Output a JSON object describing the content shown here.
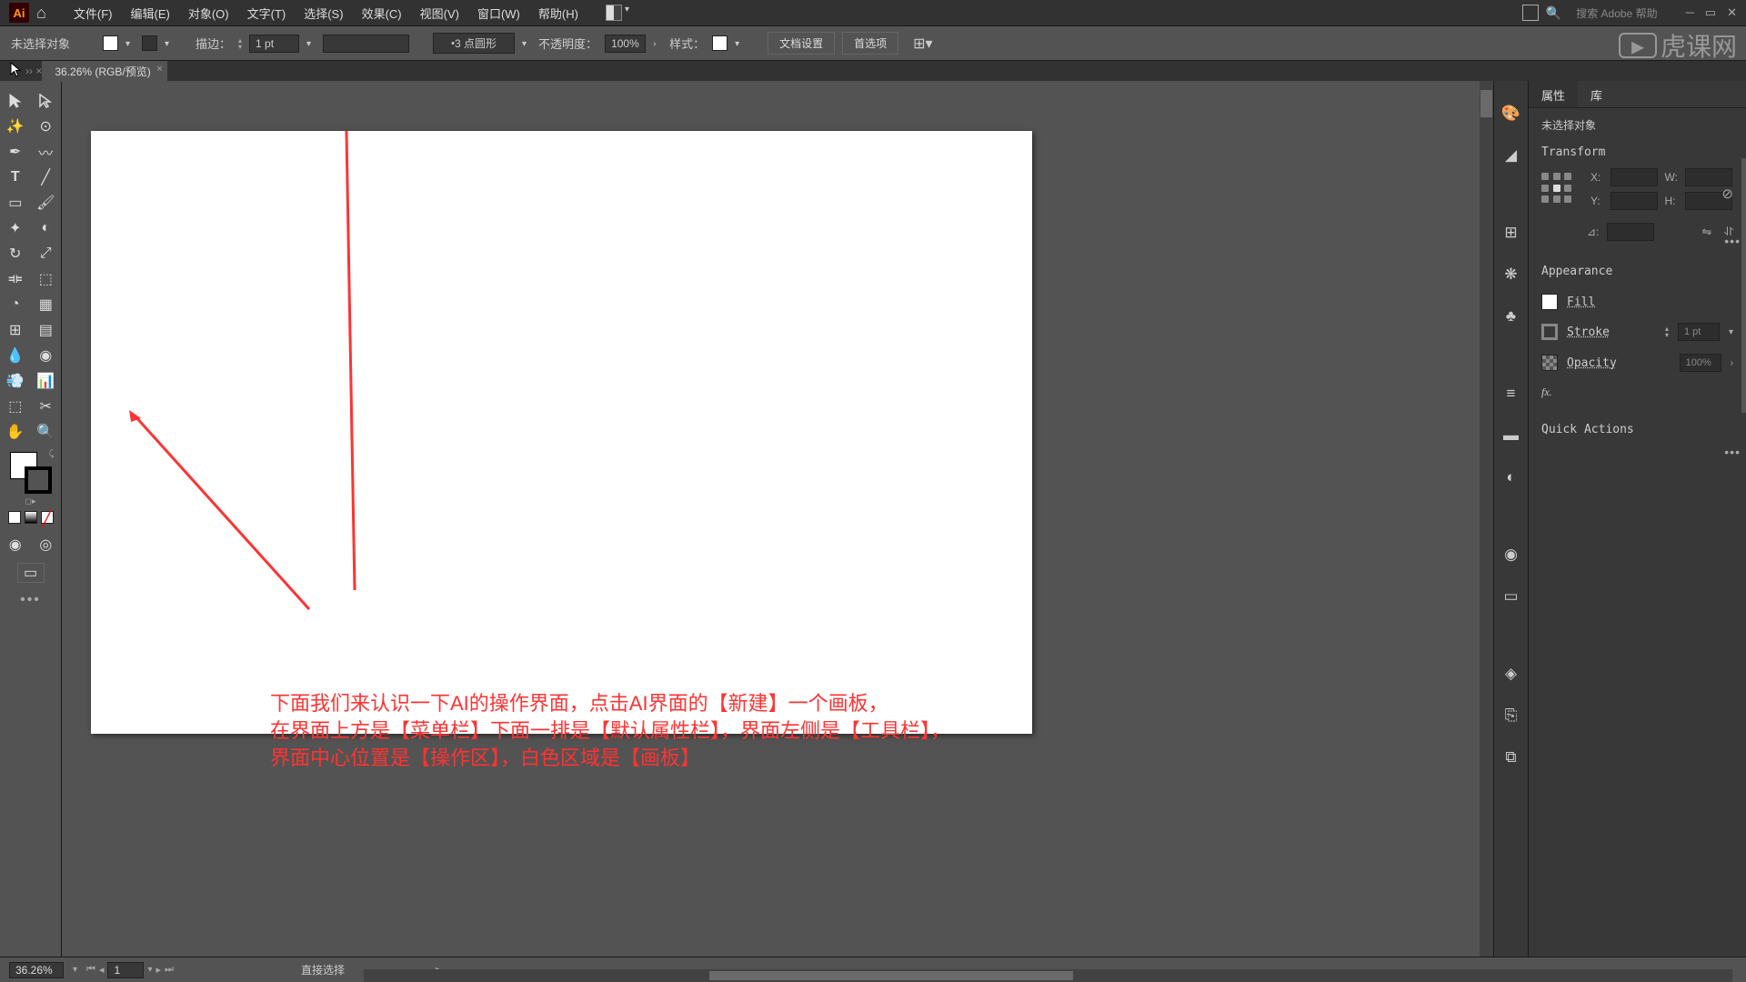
{
  "menu": {
    "file": "文件(F)",
    "edit": "编辑(E)",
    "object": "对象(O)",
    "type": "文字(T)",
    "select": "选择(S)",
    "effect": "效果(C)",
    "view": "视图(V)",
    "window": "窗口(W)",
    "help": "帮助(H)"
  },
  "search": "搜索 Adobe 帮助",
  "control": {
    "no_selection": "未选择对象",
    "stroke_label": "描边：",
    "stroke_val": "1 pt",
    "brush_val": "3 点圆形",
    "opacity_label": "不透明度：",
    "opacity_val": "100%",
    "style_label": "样式：",
    "doc_setup": "文档设置",
    "prefs": "首选项"
  },
  "doc_tab": "36.26% (RGB/预览)",
  "tutorial": {
    "l1": "下面我们来认识一下AI的操作界面，点击AI界面的【新建】一个画板，",
    "l2": "在界面上方是【菜单栏】下面一排是【默认属性栏】，界面左侧是【工具栏】，",
    "l3": "界面中心位置是【操作区】，白色区域是【画板】"
  },
  "panel": {
    "tab_props": "属性",
    "tab_lib": "库",
    "no_sel": "未选择对象",
    "transform": "Transform",
    "x_label": "X:",
    "y_label": "Y:",
    "w_label": "W:",
    "h_label": "H:",
    "x_val": "",
    "y_val": "",
    "w_val": "",
    "h_val": "",
    "angle_label": "⊿:",
    "appearance": "Appearance",
    "fill": "Fill",
    "stroke": "Stroke",
    "stroke_val": "1 pt",
    "opacity": "Opacity",
    "opacity_val": "100%",
    "fx": "fx.",
    "quick_actions": "Quick Actions"
  },
  "status": {
    "zoom": "36.26%",
    "page": "1",
    "tool": "直接选择"
  },
  "watermark": "虎课网"
}
